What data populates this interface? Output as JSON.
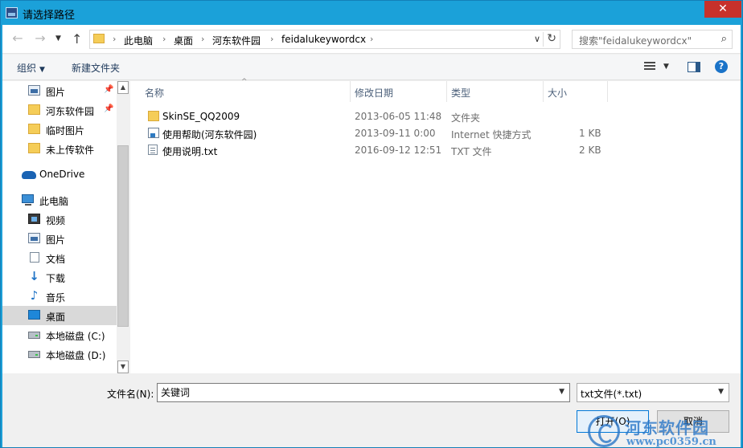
{
  "window": {
    "title": "请选择路径",
    "close_glyph": "✕"
  },
  "nav": {
    "back_glyph": "←",
    "forward_glyph": "→",
    "recent_glyph": "▼",
    "up_glyph": "↑",
    "breadcrumbs": [
      "此电脑",
      "桌面",
      "河东软件园",
      "feidalukeywordcx"
    ],
    "separator": "›",
    "address_dropdown_glyph": "∨",
    "refresh_glyph": "↻",
    "search_placeholder": "搜索\"feidalukeywordcx\"",
    "search_glyph": "⌕"
  },
  "toolbar": {
    "organize": "组织",
    "new_folder": "新建文件夹",
    "caret": "▼",
    "help_glyph": "?"
  },
  "sidebar": {
    "pin_glyph": "📌",
    "items": [
      {
        "label": "图片",
        "icon": "picture-icon",
        "pinned": true
      },
      {
        "label": "河东软件园",
        "icon": "folder-icon",
        "pinned": true
      },
      {
        "label": "临时图片",
        "icon": "folder-icon",
        "pinned": false
      },
      {
        "label": "未上传软件",
        "icon": "folder-icon",
        "pinned": false
      },
      {
        "label": "OneDrive",
        "icon": "onedrive-icon"
      },
      {
        "label": "此电脑",
        "icon": "pc-icon"
      },
      {
        "label": "视频",
        "icon": "video-icon"
      },
      {
        "label": "图片",
        "icon": "picture-icon"
      },
      {
        "label": "文档",
        "icon": "document-icon"
      },
      {
        "label": "下载",
        "icon": "download-icon",
        "glyph": "↓"
      },
      {
        "label": "音乐",
        "icon": "music-icon",
        "glyph": "♪"
      },
      {
        "label": "桌面",
        "icon": "desktop-icon",
        "selected": true
      },
      {
        "label": "本地磁盘 (C:)",
        "icon": "drive-icon"
      },
      {
        "label": "本地磁盘 (D:)",
        "icon": "drive-icon"
      }
    ],
    "scroll_up_glyph": "▲",
    "scroll_down_glyph": "▼"
  },
  "files": {
    "columns": [
      "名称",
      "修改日期",
      "类型",
      "大小"
    ],
    "sort_glyph": "^",
    "rows": [
      {
        "name": "SkinSE_QQ2009",
        "modified": "2013-06-05 11:48",
        "type": "文件夹",
        "size": "",
        "icon": "folder-icon"
      },
      {
        "name": "使用帮助(河东软件园)",
        "modified": "2013-09-11 0:00",
        "type": "Internet 快捷方式",
        "size": "1 KB",
        "icon": "internet-shortcut-icon"
      },
      {
        "name": "使用说明.txt",
        "modified": "2016-09-12 12:51",
        "type": "TXT 文件",
        "size": "2 KB",
        "icon": "text-file-icon"
      }
    ]
  },
  "footer": {
    "filename_label": "文件名(N):",
    "filename_value": "关键词",
    "filetype_value": "txt文件(*.txt)",
    "dropdown_glyph": "▼",
    "open_label": "打开(O)",
    "cancel_label": "取消"
  },
  "watermark": {
    "text": "河东软件园",
    "url": "www.pc0359.cn"
  },
  "colors": {
    "titlebar": "#1ba1d9",
    "close": "#c7312b",
    "selection": "#d9d9d9",
    "accent": "#0078d7"
  }
}
